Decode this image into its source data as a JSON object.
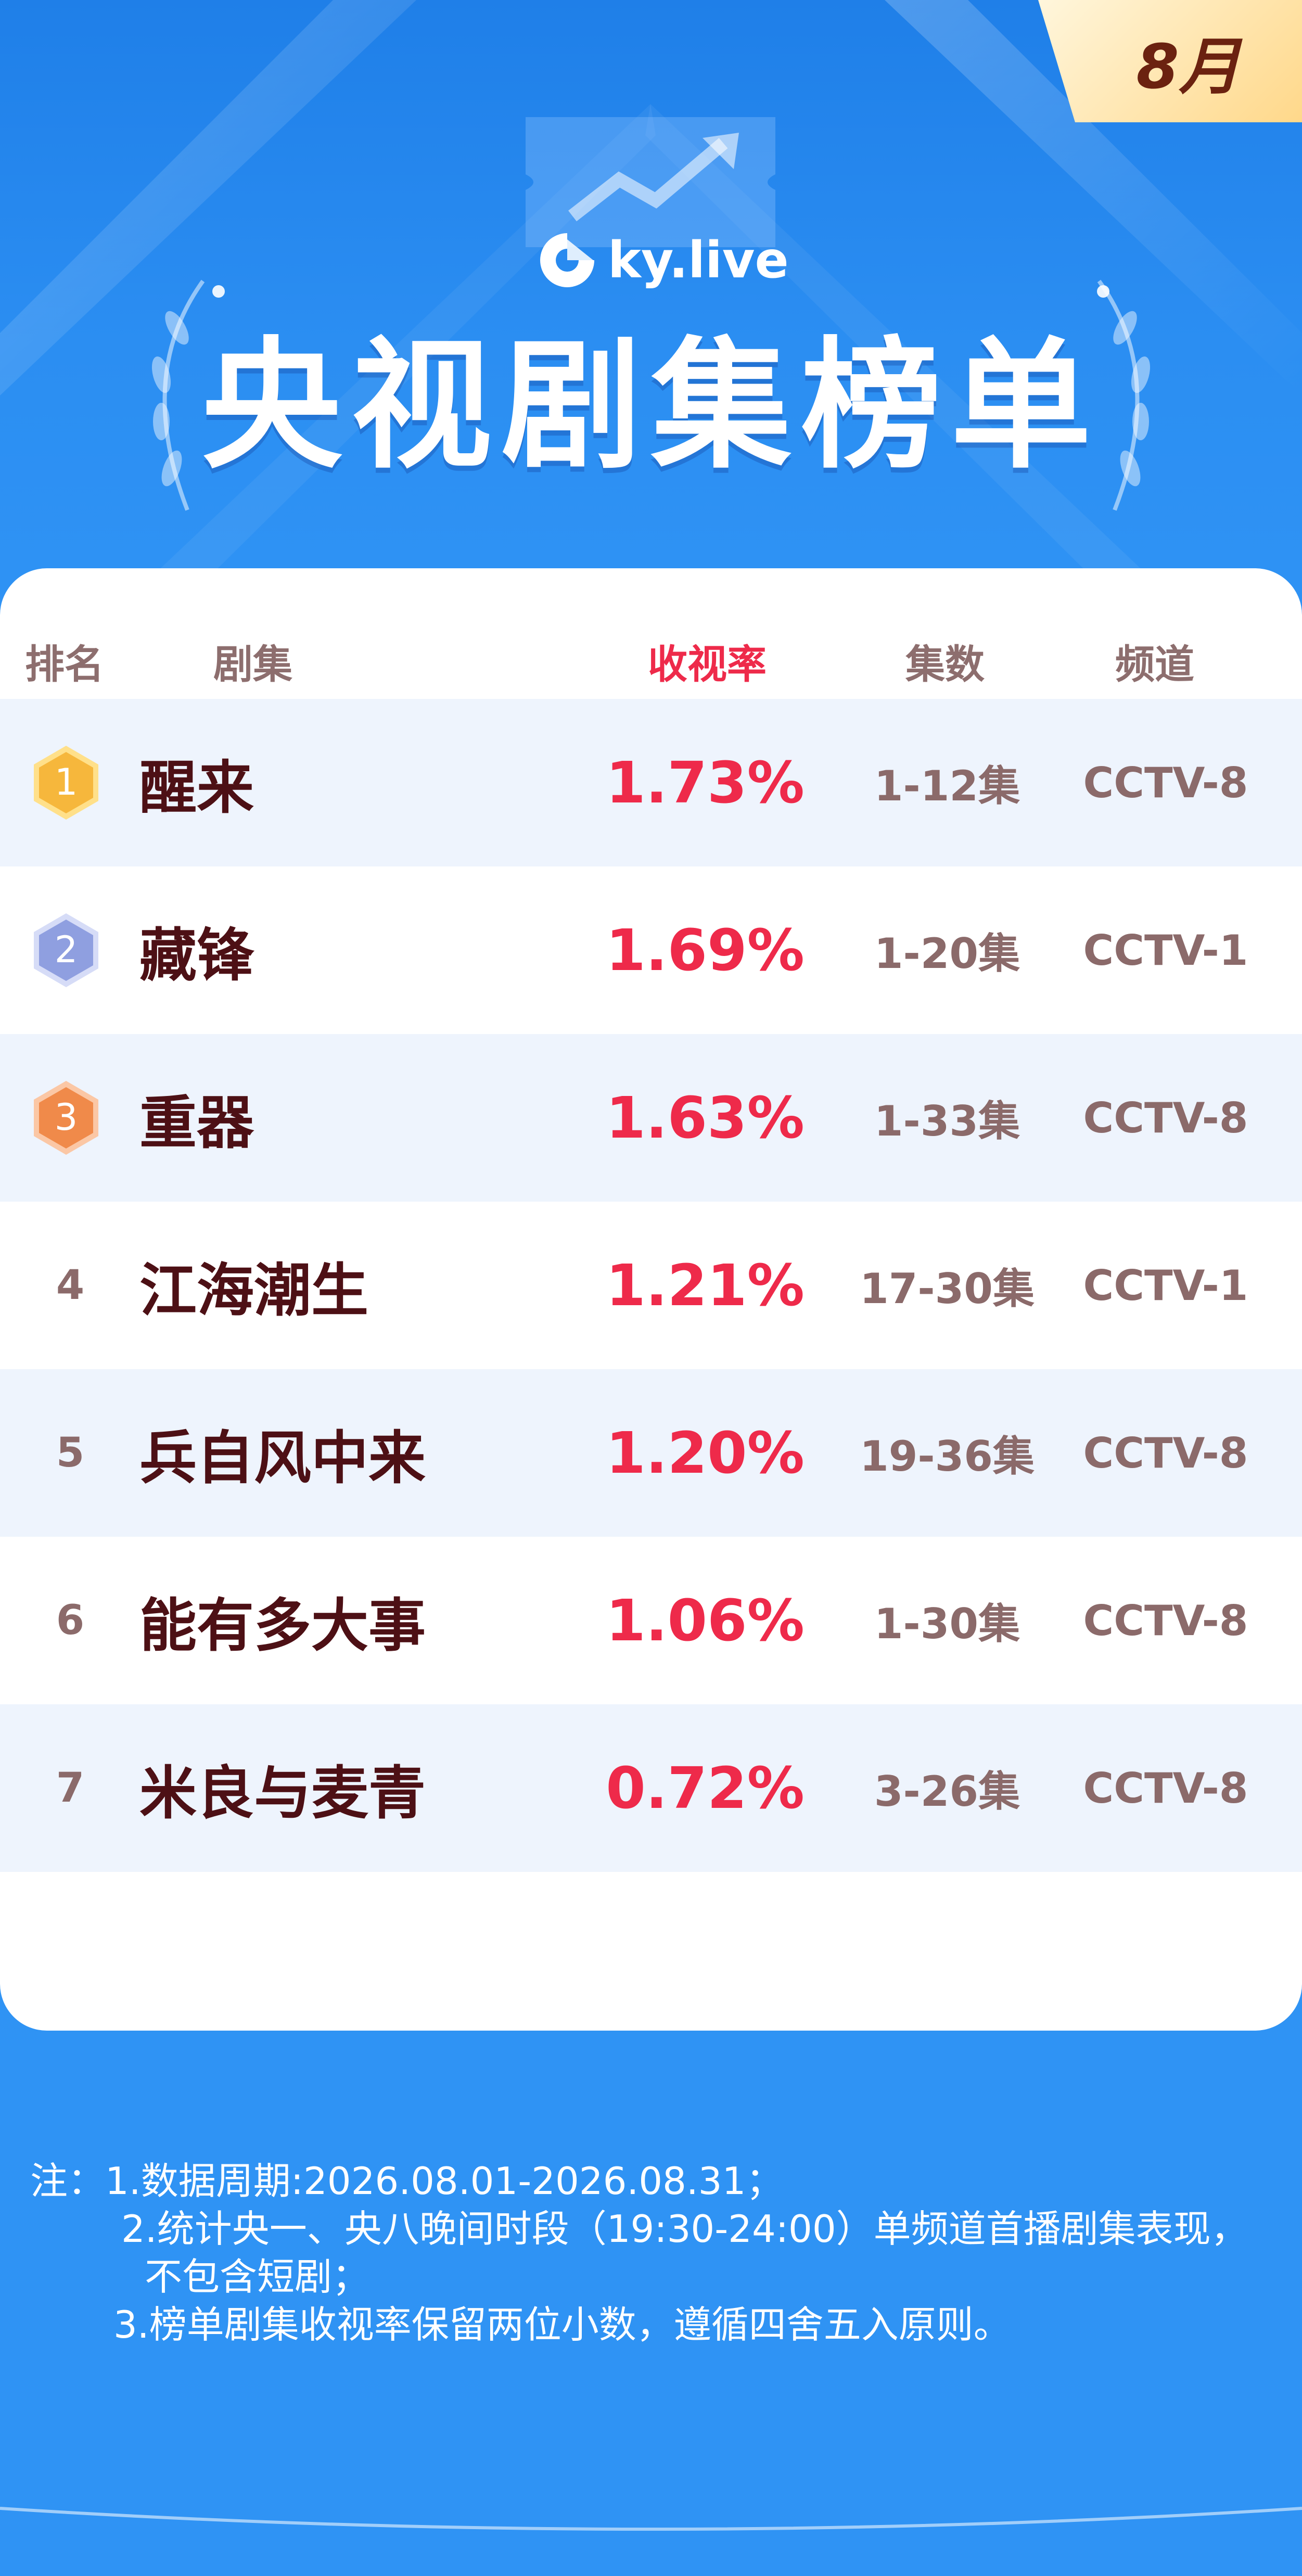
{
  "badge": {
    "month": "8月"
  },
  "brand": {
    "name": "ky.live"
  },
  "title": "央视剧集榜单",
  "table": {
    "headers": {
      "rank": "排名",
      "drama": "剧集",
      "rating": "收视率",
      "episodes": "集数",
      "channel": "频道"
    },
    "rows": [
      {
        "rank": "1",
        "name": "醒来",
        "rating": "1.73%",
        "episodes": "1-12集",
        "channel": "CCTV-8"
      },
      {
        "rank": "2",
        "name": "藏锋",
        "rating": "1.69%",
        "episodes": "1-20集",
        "channel": "CCTV-1"
      },
      {
        "rank": "3",
        "name": "重器",
        "rating": "1.63%",
        "episodes": "1-33集",
        "channel": "CCTV-8"
      },
      {
        "rank": "4",
        "name": "江海潮生",
        "rating": "1.21%",
        "episodes": "17-30集",
        "channel": "CCTV-1"
      },
      {
        "rank": "5",
        "name": "兵自风中来",
        "rating": "1.20%",
        "episodes": "19-36集",
        "channel": "CCTV-8"
      },
      {
        "rank": "6",
        "name": "能有多大事",
        "rating": "1.06%",
        "episodes": "1-30集",
        "channel": "CCTV-8"
      },
      {
        "rank": "7",
        "name": "米良与麦青",
        "rating": "0.72%",
        "episodes": "3-26集",
        "channel": "CCTV-8"
      }
    ]
  },
  "notes": {
    "line1": "注：1.数据周期:2026.08.01-2026.08.31；",
    "line2": "2.统计央一、央八晚间时段（19:30-24:00）单频道首播剧集表现，",
    "line3": "不包含短剧；",
    "line4": "3.榜单剧集收视率保留两位小数，遵循四舍五入原则。"
  },
  "colors": {
    "background": "#2f93f4",
    "rating": "#ee2a4a",
    "drama_name": "#4d1015",
    "muted": "#8b6a6a",
    "gold": "#f6b73c",
    "silver": "#8f9fe0",
    "bronze": "#f08a4a"
  },
  "icons": {
    "brand": "ky-live-logo-icon",
    "medal1": "gold-medal-icon",
    "medal2": "silver-medal-icon",
    "medal3": "bronze-medal-icon"
  }
}
